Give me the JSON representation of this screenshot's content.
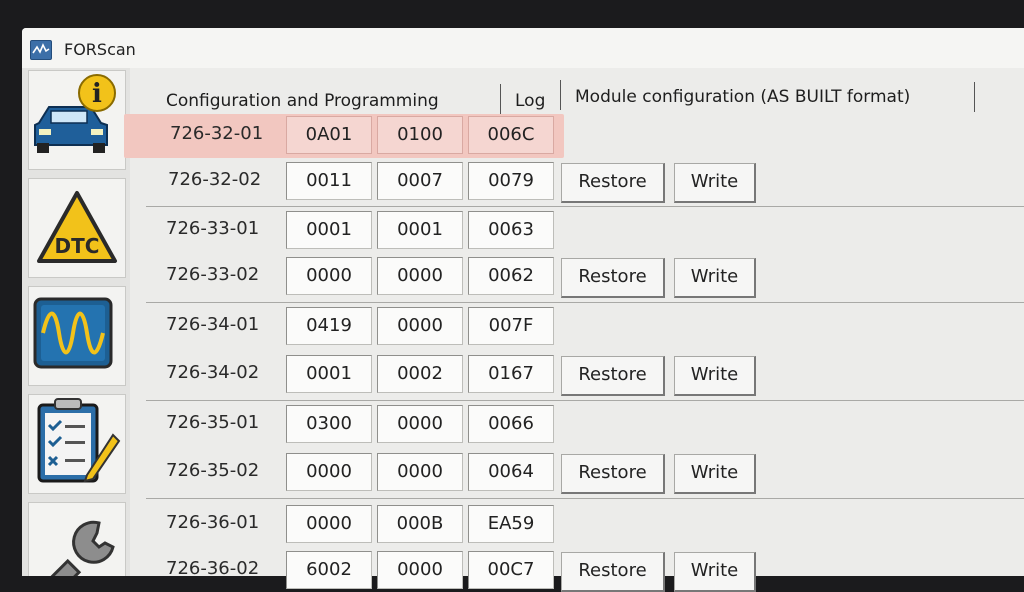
{
  "window": {
    "title": "FORScan"
  },
  "sidebar": {
    "items": [
      {
        "name": "vehicle-info",
        "icon": "car-info-icon",
        "glyph": "i"
      },
      {
        "name": "dtc",
        "icon": "dtc-warning-icon",
        "glyph": "DTC"
      },
      {
        "name": "oscilloscope",
        "icon": "oscilloscope-icon"
      },
      {
        "name": "checklist",
        "icon": "checklist-icon"
      },
      {
        "name": "service",
        "icon": "wrench-icon"
      }
    ]
  },
  "tabs": [
    {
      "label": "Configuration and Programming"
    },
    {
      "label": "Log"
    },
    {
      "label": "Module configuration (AS BUILT format)"
    }
  ],
  "colors": {
    "highlight": "#f2c7c0",
    "window_bg": "#ececea"
  },
  "rows": [
    {
      "label": "726-32-01",
      "values": [
        "0A01",
        "0100",
        "006C"
      ],
      "highlighted": true
    },
    {
      "label": "726-32-02",
      "values": [
        "0011",
        "0007",
        "0079"
      ],
      "restore": "Restore",
      "write": "Write"
    },
    {
      "label": "726-33-01",
      "values": [
        "0001",
        "0001",
        "0063"
      ]
    },
    {
      "label": "726-33-02",
      "values": [
        "0000",
        "0000",
        "0062"
      ],
      "restore": "Restore",
      "write": "Write"
    },
    {
      "label": "726-34-01",
      "values": [
        "0419",
        "0000",
        "007F"
      ]
    },
    {
      "label": "726-34-02",
      "values": [
        "0001",
        "0002",
        "0167"
      ],
      "restore": "Restore",
      "write": "Write"
    },
    {
      "label": "726-35-01",
      "values": [
        "0300",
        "0000",
        "0066"
      ]
    },
    {
      "label": "726-35-02",
      "values": [
        "0000",
        "0000",
        "0064"
      ],
      "restore": "Restore",
      "write": "Write"
    },
    {
      "label": "726-36-01",
      "values": [
        "0000",
        "000B",
        "EA59"
      ]
    },
    {
      "label": "726-36-02",
      "values": [
        "6002",
        "0000",
        "00C7"
      ],
      "restore": "Restore",
      "write": "Write"
    }
  ]
}
